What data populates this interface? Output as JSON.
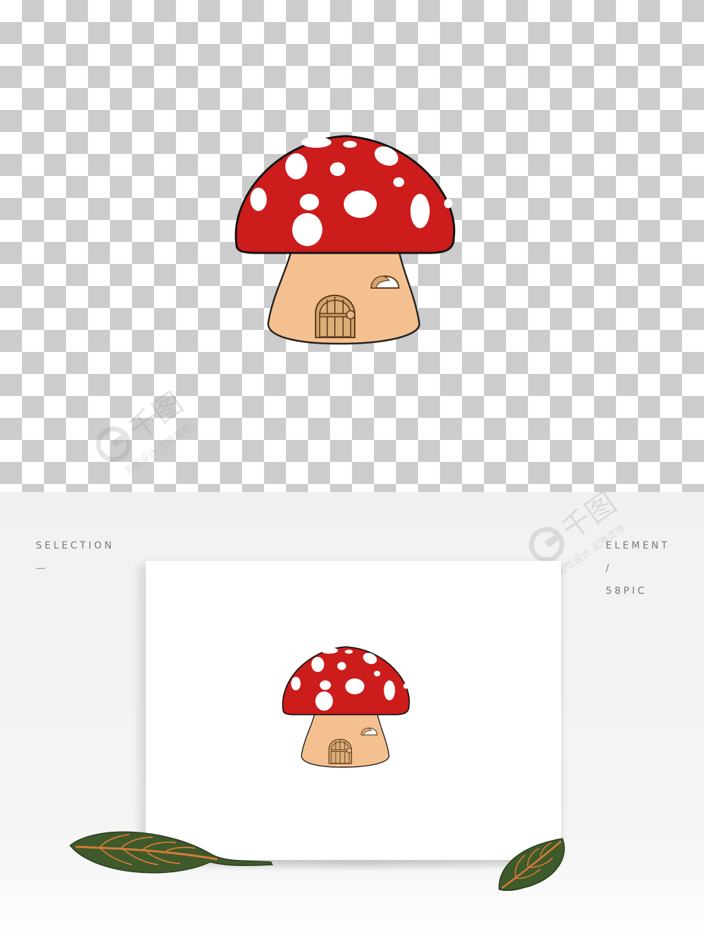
{
  "top_panel": {
    "background": "transparent-checkerboard",
    "subject": "mushroom-house-illustration"
  },
  "mockup": {
    "left_label": "SELECTION",
    "left_dash": "—",
    "right_label": "ELEMENT",
    "right_slash": "/",
    "right_brand": "58PIC"
  },
  "colors": {
    "cap_red": "#cc1c1c",
    "spots": "#ffffff",
    "stem": "#f5c08f",
    "door": "#d4a36a",
    "outline": "#222222",
    "leaf_green": "#3e5a2a",
    "leaf_vein": "#d97a3a"
  },
  "watermark": {
    "logo_text": "千图",
    "tagline": "无忧设计 无限灵感"
  }
}
